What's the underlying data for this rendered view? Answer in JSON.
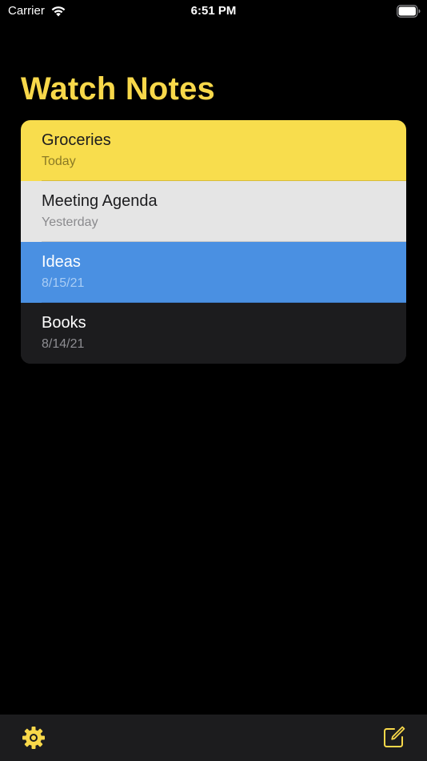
{
  "status_bar": {
    "carrier": "Carrier",
    "time": "6:51 PM",
    "wifi_icon": "wifi-icon",
    "battery_icon": "battery-icon"
  },
  "header": {
    "title": "Watch Notes"
  },
  "notes": [
    {
      "title": "Groceries",
      "date": "Today",
      "bg": "#f8dd4d",
      "title_color": "#1c1c1e",
      "date_color": "#8b7a25",
      "divider": "#d8bc3a"
    },
    {
      "title": "Meeting Agenda",
      "date": "Yesterday",
      "bg": "#e5e5e5",
      "title_color": "#1c1c1e",
      "date_color": "#8a8a8d",
      "divider": "#c8c8c8"
    },
    {
      "title": "Ideas",
      "date": "8/15/21",
      "bg": "#4a90e2",
      "title_color": "#ffffff",
      "date_color": "#a9cdf5",
      "divider": "#3f7fcb"
    },
    {
      "title": "Books",
      "date": "8/14/21",
      "bg": "#1c1c1e",
      "title_color": "#ffffff",
      "date_color": "#8e8e93",
      "divider": "transparent"
    }
  ],
  "toolbar": {
    "settings_icon": "gear-icon",
    "compose_icon": "compose-icon",
    "accent": "#f8d84a"
  },
  "colors": {
    "accent": "#f8d84a",
    "background": "#000000"
  }
}
